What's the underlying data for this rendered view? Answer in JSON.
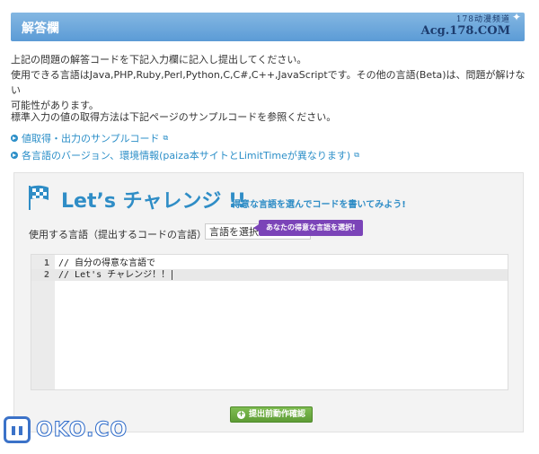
{
  "header": {
    "title": "解答欄",
    "watermark_cn": "178动漫频道",
    "watermark_site": "Acg.178.COM"
  },
  "intro": {
    "line1": "上記の問題の解答コードを下記入力欄に記入し提出してください。",
    "line2": "使用できる言語はJava,PHP,Ruby,Perl,Python,C,C#,C++,JavaScriptです。その他の言語(Beta)は、問題が解けない",
    "line3": "可能性があります。"
  },
  "note": "標準入力の値の取得方法は下記ページのサンプルコードを参照ください。",
  "links": [
    {
      "label": "値取得・出力のサンプルコード",
      "icon": "external-link-icon"
    },
    {
      "label": "各言語のバージョン、環境情報(paiza本サイトとLimitTimeが異なります)",
      "icon": "external-link-icon"
    }
  ],
  "challenge": {
    "title": "Let’s チャレンジ !!",
    "subtitle": "得意な言語を選んでコードを書いてみよう!",
    "lang_label": "使用する言語（提出するコードの言語）",
    "lang_select_value": "言語を選択",
    "tooltip": "あなたの得意な言語を選択!",
    "code_lines": [
      {
        "num": "1",
        "text": "// 自分の得意な言語で"
      },
      {
        "num": "2",
        "text": "// Let's チャレンジ！！"
      }
    ],
    "submit_label": "提出前動作確認"
  },
  "watermark_bottom": {
    "text": "OKO.CO"
  },
  "colors": {
    "accent": "#2f8dc6",
    "header": "#6aa6dc",
    "tooltip": "#7b44b8",
    "button": "#5e9c35"
  }
}
